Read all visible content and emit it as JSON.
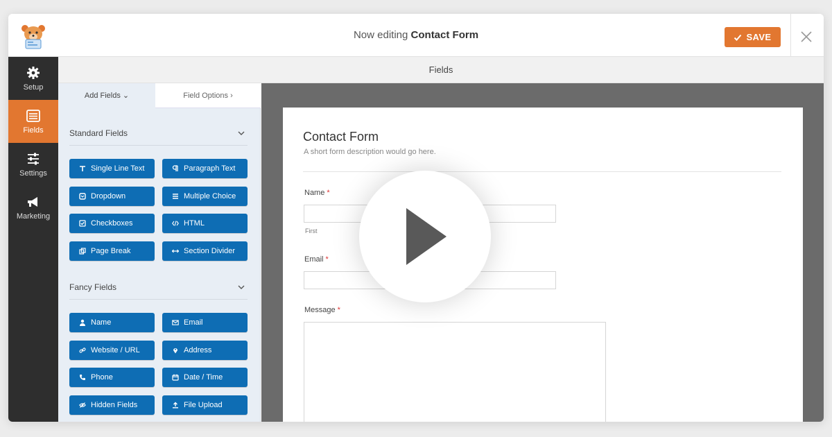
{
  "header": {
    "title_prefix": "Now editing",
    "form_name": "Contact Form",
    "save_label": "SAVE"
  },
  "nav": [
    {
      "label": "Setup",
      "icon": "gear-icon",
      "active": false
    },
    {
      "label": "Fields",
      "icon": "fields-icon",
      "active": true
    },
    {
      "label": "Settings",
      "icon": "sliders-icon",
      "active": false
    },
    {
      "label": "Marketing",
      "icon": "megaphone-icon",
      "active": false
    }
  ],
  "fields_header": "Fields",
  "panel": {
    "tab_add": "Add Fields",
    "tab_options": "Field Options",
    "standard_title": "Standard Fields",
    "standard": [
      {
        "label": "Single Line Text",
        "icon": "text-icon"
      },
      {
        "label": "Paragraph Text",
        "icon": "paragraph-icon"
      },
      {
        "label": "Dropdown",
        "icon": "dropdown-icon"
      },
      {
        "label": "Multiple Choice",
        "icon": "list-icon"
      },
      {
        "label": "Checkboxes",
        "icon": "checkbox-icon"
      },
      {
        "label": "HTML",
        "icon": "code-icon"
      },
      {
        "label": "Page Break",
        "icon": "copy-icon"
      },
      {
        "label": "Section Divider",
        "icon": "arrows-icon"
      }
    ],
    "fancy_title": "Fancy Fields",
    "fancy": [
      {
        "label": "Name",
        "icon": "user-icon"
      },
      {
        "label": "Email",
        "icon": "envelope-icon"
      },
      {
        "label": "Website / URL",
        "icon": "link-icon"
      },
      {
        "label": "Address",
        "icon": "map-pin-icon"
      },
      {
        "label": "Phone",
        "icon": "phone-icon"
      },
      {
        "label": "Date / Time",
        "icon": "calendar-icon"
      },
      {
        "label": "Hidden Fields",
        "icon": "eye-slash-icon"
      },
      {
        "label": "File Upload",
        "icon": "upload-icon"
      }
    ]
  },
  "form": {
    "title": "Contact Form",
    "description": "A short form description would go here.",
    "name_label": "Name",
    "name_sub": "First",
    "email_label": "Email",
    "message_label": "Message",
    "required_mark": "*"
  },
  "colors": {
    "accent": "#e27730",
    "button_blue": "#0e6db4",
    "nav_dark": "#2e2e2e",
    "preview_gray": "#6b6b6b"
  }
}
